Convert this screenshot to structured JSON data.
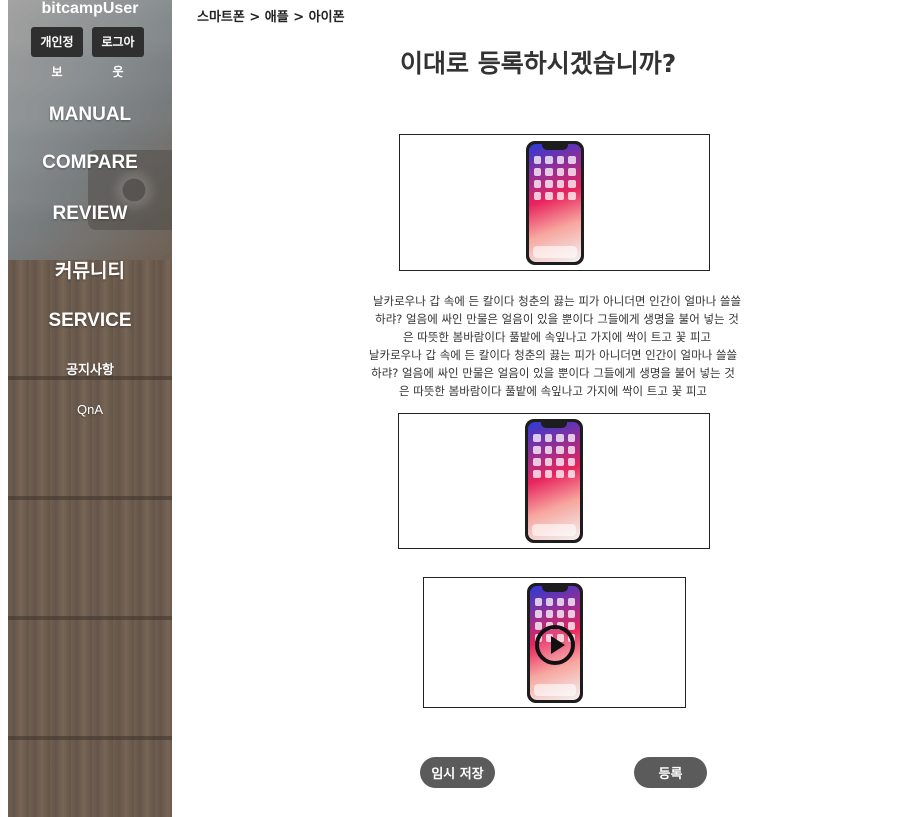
{
  "sidebar": {
    "user_name": "bitcampUser",
    "profile_button": "개인정보",
    "logout_button": "로그아웃",
    "menu": [
      "MANUAL",
      "COMPARE",
      "REVIEW",
      "커뮤니티",
      "SERVICE",
      "공지사항",
      "QnA"
    ]
  },
  "main": {
    "breadcrumb": "스마트폰 > 애플   > 아이폰",
    "title": "이대로 등록하시겠습니까?",
    "descriptions": [
      "날카로우나 갑 속에 든 칼이다 청춘의 끓는 피가 아니더면 인간이 얼마나 쓸쓸하랴? 얼음에 싸인 만물은 얼음이 있을 뿐이다 그들에게 생명을 불어 넣는 것은 따뜻한 봄바람이다 풀밭에 속잎나고 가지에 싹이 트고 꽃 피고",
      "날카로우나 갑 속에 든 칼이다 청춘의 끓는 피가 아니더면 인간이 얼마나 쓸쓸하랴? 얼음에 싸인 만물은 얼음이 있을 뿐이다 그들에게 생명을 불어 넣는 것은 따뜻한 봄바람이다 풀밭에 속잎나고 가지에 싹이 트고 꽃 피고"
    ],
    "temp_save_button": "임시 저장",
    "submit_button": "등록"
  }
}
